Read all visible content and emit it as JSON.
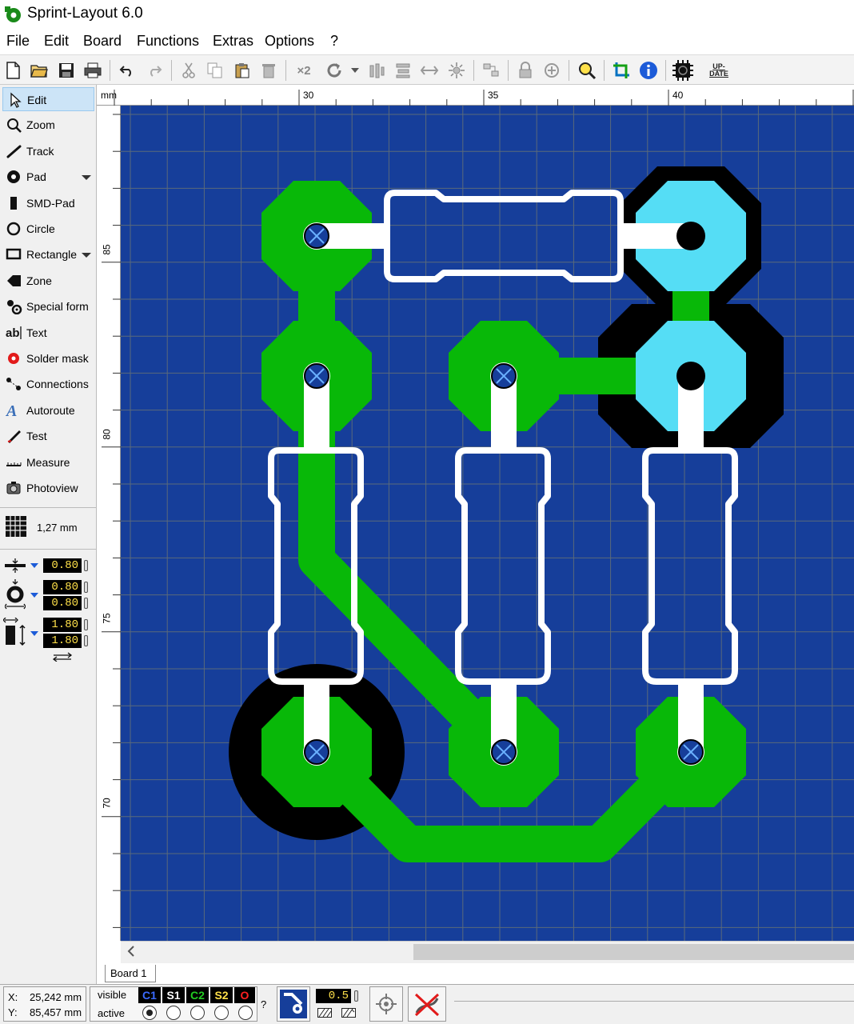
{
  "app": {
    "title": "Sprint-Layout 6.0"
  },
  "menu": [
    "File",
    "Edit",
    "Board",
    "Functions",
    "Extras",
    "Options",
    "?"
  ],
  "toolbar": {
    "x2_label": "×2",
    "update_label": "UP-\nDATE"
  },
  "tools": [
    {
      "label": "Edit",
      "icon": "cursor-icon",
      "active": true
    },
    {
      "label": "Zoom",
      "icon": "zoom-icon"
    },
    {
      "label": "Track",
      "icon": "track-icon"
    },
    {
      "label": "Pad",
      "icon": "pad-icon",
      "dropdown": true
    },
    {
      "label": "SMD-Pad",
      "icon": "smd-pad-icon"
    },
    {
      "label": "Circle",
      "icon": "circle-icon"
    },
    {
      "label": "Rectangle",
      "icon": "rectangle-icon",
      "dropdown": true
    },
    {
      "label": "Zone",
      "icon": "zone-icon"
    },
    {
      "label": "Special form",
      "icon": "special-form-icon"
    },
    {
      "label": "Text",
      "icon": "text-icon"
    },
    {
      "label": "Solder mask",
      "icon": "solder-mask-icon"
    },
    {
      "label": "Connections",
      "icon": "connections-icon"
    },
    {
      "label": "Autoroute",
      "icon": "autoroute-icon"
    },
    {
      "label": "Test",
      "icon": "test-icon"
    },
    {
      "label": "Measure",
      "icon": "measure-icon"
    },
    {
      "label": "Photoview",
      "icon": "photoview-icon"
    }
  ],
  "grid": {
    "label": "1,27 mm"
  },
  "params": {
    "track_width": "0.80",
    "pad_outer": "0.80",
    "pad_inner": "0.80",
    "smd_w": "1.80",
    "smd_h": "1.80"
  },
  "ruler": {
    "unit": "mm",
    "top_labels": [
      "30",
      "35",
      "40"
    ],
    "left_labels": [
      "85",
      "80",
      "75",
      "70"
    ]
  },
  "colors": {
    "board": "#163e9a",
    "grid": "#5a6a7a",
    "copper_green": "#08b808",
    "copper_cyan": "#55ddf5",
    "mask_black": "#000000",
    "silk_white": "#ffffff"
  },
  "tab": {
    "label": "Board 1"
  },
  "status": {
    "x_label": "X:",
    "x_value": "25,242 mm",
    "y_label": "Y:",
    "y_value": "85,457 mm",
    "visible_label": "visible",
    "active_label": "active",
    "layers": [
      {
        "name": "C1",
        "color": "#3a6bff"
      },
      {
        "name": "S1",
        "color": "#ffffff"
      },
      {
        "name": "C2",
        "color": "#22cc22"
      },
      {
        "name": "S2",
        "color": "#ffe14a"
      },
      {
        "name": "O",
        "color": "#ff2020"
      }
    ],
    "active_layer": "C1",
    "help": "?",
    "zoom_value": "0.5"
  }
}
